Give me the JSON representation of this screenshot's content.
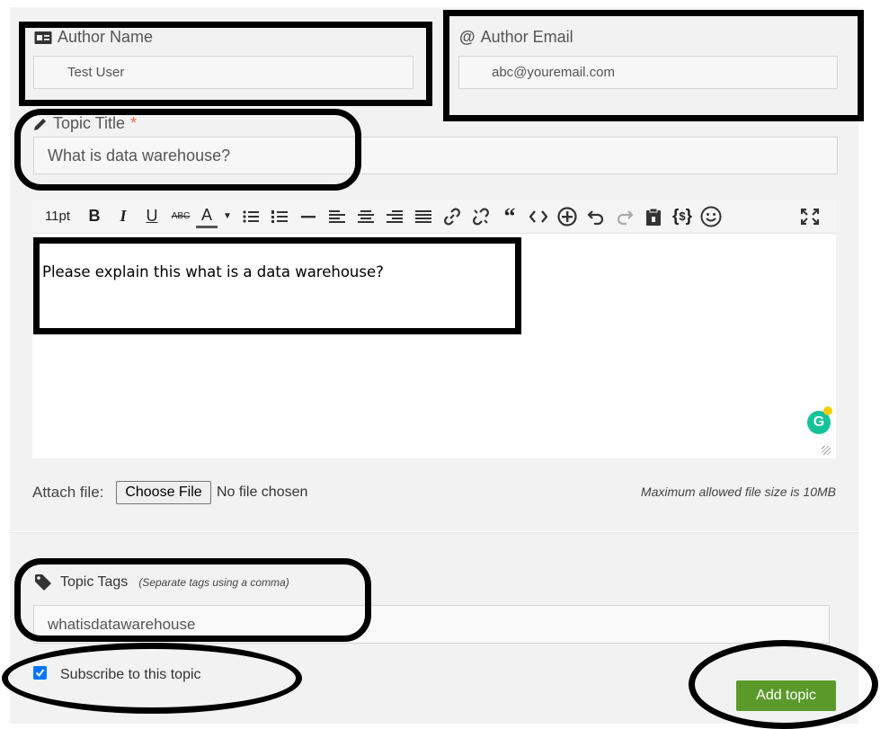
{
  "author_name": {
    "label": "Author Name",
    "value": "Test User"
  },
  "author_email": {
    "label": "Author Email",
    "value": "abc@youremail.com"
  },
  "topic_title": {
    "label": "Topic Title",
    "required_mark": "*",
    "value": "What is data warehouse?"
  },
  "editor": {
    "font_size": "11pt",
    "content": "Please explain this what is a data warehouse?",
    "toolbar_icons": [
      "bold-icon",
      "italic-icon",
      "underline-icon",
      "strikethrough-icon",
      "text-color-icon",
      "chevron-down-icon",
      "bullet-list-icon",
      "numbered-list-icon",
      "horizontal-rule-icon",
      "align-left-icon",
      "align-center-icon",
      "align-right-icon",
      "align-justify-icon",
      "link-icon",
      "unlink-icon",
      "blockquote-icon",
      "code-icon",
      "insert-icon",
      "undo-icon",
      "redo-icon",
      "paste-icon",
      "code-block-icon",
      "emoji-icon",
      "fullscreen-icon"
    ],
    "grammarly_icon": "grammarly-icon"
  },
  "attach": {
    "label": "Attach file:",
    "button": "Choose File",
    "status": "No file chosen",
    "note": "Maximum allowed file size is 10MB"
  },
  "tags": {
    "label": "Topic Tags",
    "hint": "(Separate tags using a comma)",
    "value": "whatisdatawarehouse"
  },
  "subscribe": {
    "label": "Subscribe to this topic",
    "checked": true
  },
  "submit": {
    "label": "Add topic",
    "color": "#5b9a2a"
  },
  "colors": {
    "required": "#e8704a",
    "annotation": "#000000"
  }
}
